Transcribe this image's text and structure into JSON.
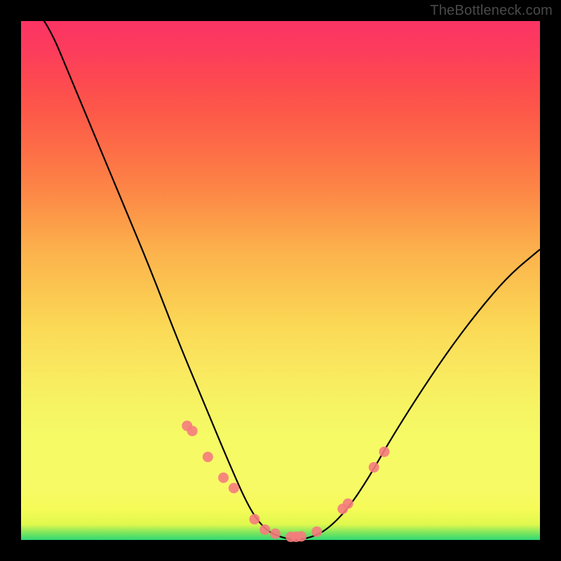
{
  "watermark": "TheBottleneck.com",
  "colors": {
    "frame": "#000000",
    "gradient_top": "#fc3464",
    "gradient_mid": "#f6fb58",
    "gradient_bottom": "#2fd875",
    "curve": "#000000",
    "marker": "#f57b7d"
  },
  "chart_data": {
    "type": "line",
    "title": "",
    "xlabel": "",
    "ylabel": "",
    "xlim": [
      0,
      100
    ],
    "ylim": [
      0,
      100
    ],
    "series": [
      {
        "name": "bottleneck-curve",
        "x": [
          0,
          5,
          10,
          15,
          20,
          25,
          30,
          35,
          40,
          44,
          47,
          50,
          53,
          56,
          59,
          63,
          67,
          71,
          76,
          82,
          88,
          94,
          100
        ],
        "y": [
          105,
          100,
          88,
          76,
          64,
          52,
          39,
          27,
          15,
          6,
          2,
          0.5,
          0,
          0.5,
          2,
          6,
          12,
          19,
          27,
          36,
          44,
          51,
          56
        ]
      }
    ],
    "markers": {
      "name": "highlighted-points",
      "x": [
        32,
        33,
        36,
        39,
        41,
        45,
        47,
        49,
        52,
        53,
        54,
        57,
        62,
        63,
        68,
        70
      ],
      "y": [
        22,
        21,
        16,
        12,
        10,
        4,
        2,
        1.2,
        0.6,
        0.6,
        0.7,
        1.6,
        6,
        7,
        14,
        17
      ]
    }
  }
}
